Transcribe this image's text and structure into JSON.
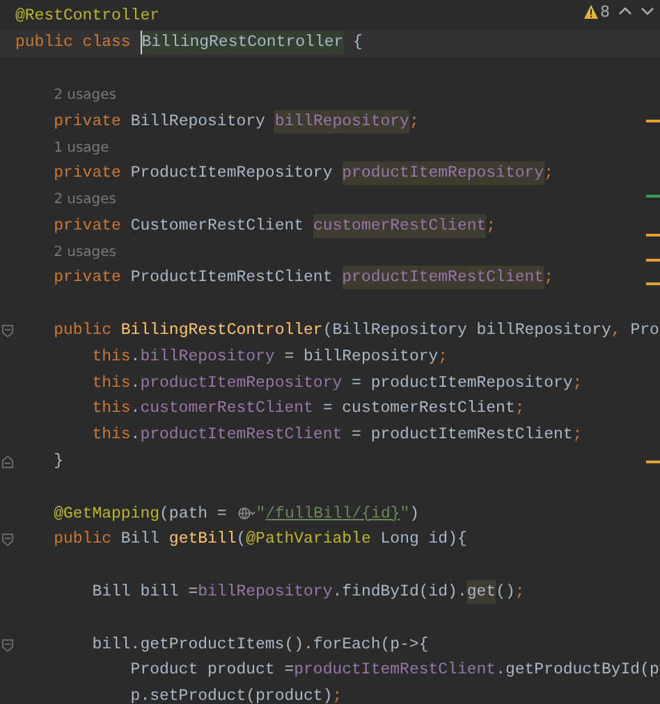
{
  "toolbar": {
    "warning_count": "8"
  },
  "lines": [
    {
      "kind": "code",
      "tokens": [
        {
          "text": "@RestController",
          "kind": "annotation"
        }
      ]
    },
    {
      "kind": "code",
      "current": true,
      "tokens": [
        {
          "text": "public class ",
          "kind": "keyword"
        },
        {
          "text": "BillingRestController",
          "kind": "plain",
          "highlighted": true,
          "declaration": true,
          "caret": true
        },
        {
          "text": " {",
          "kind": "plain"
        }
      ],
      "children": [
        {
          "kind": "blank"
        },
        {
          "kind": "hint",
          "text": "2 usages"
        },
        {
          "kind": "code",
          "tokens": [
            {
              "text": "private ",
              "kind": "keyword"
            },
            {
              "text": "BillRepository ",
              "kind": "plain"
            },
            {
              "text": "billRepository",
              "kind": "field",
              "highlighted": true
            },
            {
              "text": ";",
              "kind": "punct"
            }
          ]
        },
        {
          "kind": "hint",
          "text": "1 usage"
        },
        {
          "kind": "code",
          "tokens": [
            {
              "text": "private ",
              "kind": "keyword"
            },
            {
              "text": "ProductItemRepository ",
              "kind": "plain"
            },
            {
              "text": "productItemRepository",
              "kind": "field",
              "highlighted": true
            },
            {
              "text": ";",
              "kind": "punct"
            }
          ]
        },
        {
          "kind": "hint",
          "text": "2 usages"
        },
        {
          "kind": "code",
          "tokens": [
            {
              "text": "private ",
              "kind": "keyword"
            },
            {
              "text": "CustomerRestClient ",
              "kind": "plain"
            },
            {
              "text": "customerRestClient",
              "kind": "field",
              "highlighted": true
            },
            {
              "text": ";",
              "kind": "punct"
            }
          ]
        },
        {
          "kind": "hint",
          "text": "2 usages"
        },
        {
          "kind": "code",
          "tokens": [
            {
              "text": "private ",
              "kind": "keyword"
            },
            {
              "text": "ProductItemRestClient ",
              "kind": "plain"
            },
            {
              "text": "productItemRestClient",
              "kind": "field",
              "highlighted": true
            },
            {
              "text": ";",
              "kind": "punct"
            }
          ]
        },
        {
          "kind": "blank"
        },
        {
          "kind": "code",
          "fold_start": true,
          "tokens": [
            {
              "text": "public ",
              "kind": "keyword"
            },
            {
              "text": "BillingRestController",
              "kind": "method"
            },
            {
              "text": "(BillRepository billRepository",
              "kind": "plain"
            },
            {
              "text": ", ",
              "kind": "punct"
            },
            {
              "text": "Pro",
              "kind": "plain"
            }
          ],
          "children": [
            {
              "kind": "code",
              "tokens": [
                {
                  "text": "this",
                  "kind": "keyword"
                },
                {
                  "text": ".",
                  "kind": "plain"
                },
                {
                  "text": "billRepository",
                  "kind": "field"
                },
                {
                  "text": " = billRepository",
                  "kind": "plain"
                },
                {
                  "text": ";",
                  "kind": "punct"
                }
              ]
            },
            {
              "kind": "code",
              "tokens": [
                {
                  "text": "this",
                  "kind": "keyword"
                },
                {
                  "text": ".",
                  "kind": "plain"
                },
                {
                  "text": "productItemRepository",
                  "kind": "field"
                },
                {
                  "text": " = productItemRepository",
                  "kind": "plain"
                },
                {
                  "text": ";",
                  "kind": "punct"
                }
              ]
            },
            {
              "kind": "code",
              "tokens": [
                {
                  "text": "this",
                  "kind": "keyword"
                },
                {
                  "text": ".",
                  "kind": "plain"
                },
                {
                  "text": "customerRestClient",
                  "kind": "field"
                },
                {
                  "text": " = customerRestClient",
                  "kind": "plain"
                },
                {
                  "text": ";",
                  "kind": "punct"
                }
              ]
            },
            {
              "kind": "code",
              "tokens": [
                {
                  "text": "this",
                  "kind": "keyword"
                },
                {
                  "text": ".",
                  "kind": "plain"
                },
                {
                  "text": "productItemRestClient",
                  "kind": "field"
                },
                {
                  "text": " = productItemRestClient",
                  "kind": "plain"
                },
                {
                  "text": ";",
                  "kind": "punct"
                }
              ]
            }
          ]
        },
        {
          "kind": "code",
          "fold_end": true,
          "tokens": [
            {
              "text": "}",
              "kind": "plain"
            }
          ]
        },
        {
          "kind": "blank"
        },
        {
          "kind": "code",
          "tokens": [
            {
              "text": "@GetMapping",
              "kind": "annotation"
            },
            {
              "text": "(path = ",
              "kind": "plain"
            },
            {
              "kind": "endpoint"
            },
            {
              "text": "\"",
              "kind": "string"
            },
            {
              "text": "/fullBill/{id}",
              "kind": "url"
            },
            {
              "text": "\"",
              "kind": "string"
            },
            {
              "text": ")",
              "kind": "plain"
            }
          ]
        },
        {
          "kind": "code",
          "fold_start": true,
          "tokens": [
            {
              "text": "public ",
              "kind": "keyword"
            },
            {
              "text": "Bill ",
              "kind": "plain"
            },
            {
              "text": "getBill",
              "kind": "method"
            },
            {
              "text": "(",
              "kind": "plain"
            },
            {
              "text": "@PathVariable ",
              "kind": "annotation"
            },
            {
              "text": "Long id){",
              "kind": "plain"
            }
          ],
          "children": [
            {
              "kind": "blank"
            },
            {
              "kind": "code",
              "tokens": [
                {
                  "text": "Bill bill =",
                  "kind": "plain"
                },
                {
                  "text": "billRepository",
                  "kind": "field"
                },
                {
                  "text": ".findById(id).",
                  "kind": "plain"
                },
                {
                  "text": "get",
                  "kind": "plain",
                  "highlighted": true
                },
                {
                  "text": "()",
                  "kind": "plain"
                },
                {
                  "text": ";",
                  "kind": "punct"
                }
              ]
            },
            {
              "kind": "blank"
            },
            {
              "kind": "code",
              "fold_start": true,
              "tokens": [
                {
                  "text": "bill.getProductItems().forEach(p->{",
                  "kind": "plain"
                }
              ],
              "children": [
                {
                  "kind": "code",
                  "tokens": [
                    {
                      "text": "Product product =",
                      "kind": "plain"
                    },
                    {
                      "text": "productItemRestClient",
                      "kind": "field"
                    },
                    {
                      "text": ".getProductById(p",
                      "kind": "plain"
                    }
                  ]
                },
                {
                  "kind": "code",
                  "tokens": [
                    {
                      "text": "p.setProduct(product)",
                      "kind": "plain"
                    },
                    {
                      "text": ";",
                      "kind": "punct"
                    }
                  ]
                }
              ]
            }
          ]
        }
      ]
    }
  ]
}
